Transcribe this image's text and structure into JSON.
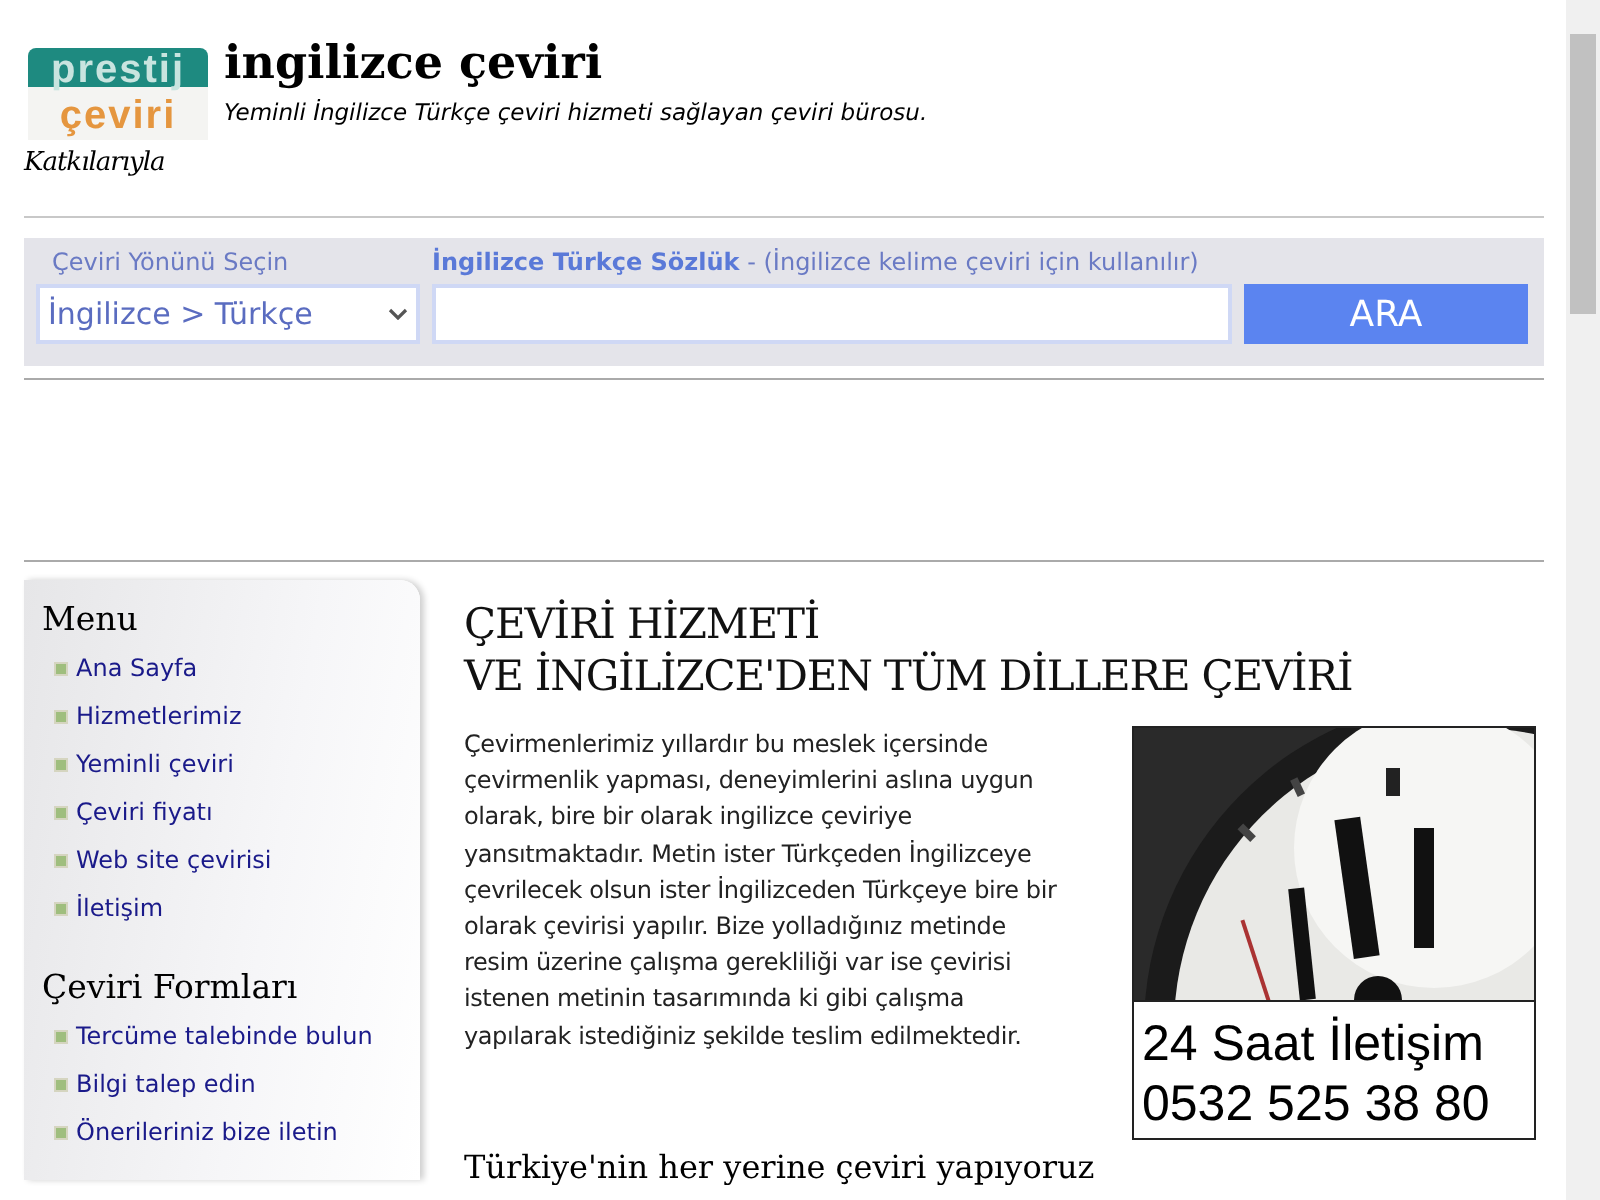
{
  "logo": {
    "line_1": "prestij",
    "line_2": "çeviri",
    "tagline": "Katkılarıyla"
  },
  "header": {
    "title": "ingilizce çeviri",
    "subtitle": "Yeminli İngilizce Türkçe çeviri hizmeti sağlayan çeviri bürosu."
  },
  "search": {
    "direction_label": "Çeviri Yönünü Seçin",
    "dictionary_label": "İngilizce Türkçe Sözlük",
    "dictionary_hint": " - (İngilizce kelime çeviri için kullanılır)",
    "direction_value": "İngilizce > Türkçe",
    "button": "ARA"
  },
  "sidebar": {
    "sections": [
      {
        "title": "Menu",
        "items": [
          "Ana Sayfa",
          "Hizmetlerimiz",
          "Yeminli çeviri",
          "Çeviri fiyatı",
          "Web site çevirisi",
          "İletişim"
        ]
      },
      {
        "title": "Çeviri Formları",
        "items": [
          "Tercüme talebinde bulun",
          "Bilgi talep edin",
          "Önerileriniz bize iletin"
        ]
      }
    ]
  },
  "article": {
    "heading_lines": [
      "ÇEVİRİ HİZMETİ",
      "VE İNGİLİZCE'DEN TÜM DİLLERE ÇEVİRİ"
    ],
    "paragraph": "Çevirmenlerimiz yıllardır bu meslek içersinde çevirmenlik yapması, deneyimlerini aslına uygun olarak, bire bir olarak ingilizce çeviriye yansıtmaktadır. Metin ister Türkçeden İngilizceye çevrilecek olsun ister İngilizceden Türkçeye bire bir olarak çevirisi yapılır. Bize yolladığınız metinde resim üzerine çalışma gerekliliği var ise çevirisi istenen metinin tasarımında ki gibi çalışma yapılarak istediğiniz şekilde teslim edilmektedir.",
    "banner": {
      "picture": {
        "kind": "picture"
      },
      "lines": [
        "24 Saat İletişim",
        "0532 525 38 80"
      ]
    },
    "subheading": "Türkiye'nin her yerine çeviri yapıyoruz"
  }
}
